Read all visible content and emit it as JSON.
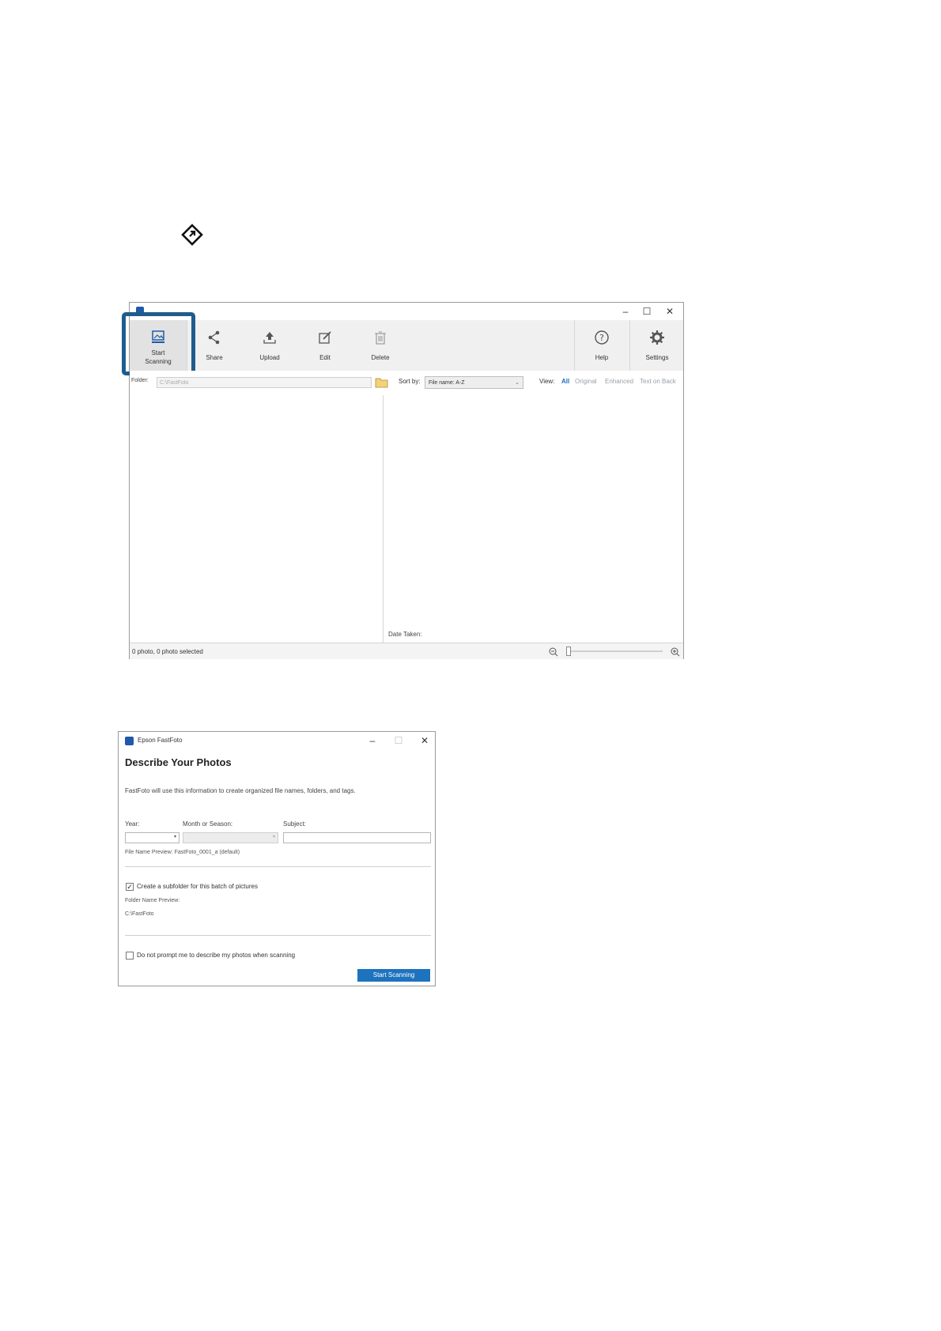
{
  "main_window": {
    "toolbar": {
      "start_scanning": "Start\nScanning",
      "share": "Share",
      "upload": "Upload",
      "edit": "Edit",
      "delete": "Delete",
      "help": "Help",
      "settings": "Settings"
    },
    "folder_label": "Folder:",
    "folder_value": "C:\\FastFoto",
    "sort_by_label": "Sort by:",
    "sort_by_value": "File name: A-Z",
    "view_label": "View:",
    "view_options": [
      "All",
      "Original",
      "Enhanced",
      "Text on Back"
    ],
    "date_taken_label": "Date Taken:",
    "status_text": "0 photo, 0 photo selected"
  },
  "dialog": {
    "app_title": "Epson FastFoto",
    "heading": "Describe Your Photos",
    "description": "FastFoto will use this information to create organized file names, folders, and tags.",
    "year_label": "Year:",
    "month_label": "Month or Season:",
    "subject_label": "Subject:",
    "file_name_preview": "File Name Preview: FastFoto_0001_a (default)",
    "subfolder_label": "Create a subfolder for this batch of pictures",
    "subfolder_checked": true,
    "folder_name_preview_label": "Folder Name Preview:",
    "folder_name_preview_value": "C:\\FastFoto",
    "no_prompt_label": "Do not prompt me to describe my photos when scanning",
    "no_prompt_checked": false,
    "start_button": "Start Scanning"
  },
  "colors": {
    "highlight": "#1f5c8c",
    "accent_blue": "#1e73be"
  }
}
